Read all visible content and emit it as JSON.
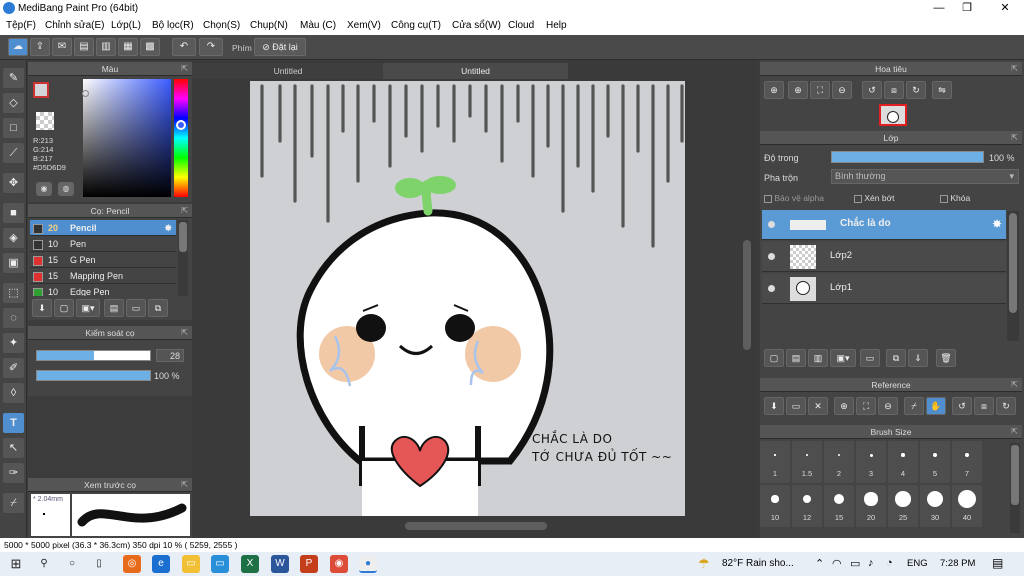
{
  "window": {
    "title": "MediBang Paint Pro (64bit)",
    "minimize": "—",
    "restore": "❐",
    "close": "✕"
  },
  "menu": [
    "Tệp(F)",
    "Chỉnh sửa(E)",
    "Lớp(L)",
    "Bộ lọc(R)",
    "Chọn(S)",
    "Chụp(N)",
    "Màu (C)",
    "Xem(V)",
    "Công cụ(T)",
    "Cửa sổ(W)",
    "Cloud",
    "Help"
  ],
  "toolbar": {
    "shortcut_label": "Phím",
    "reset_label": "Đặt lại"
  },
  "color_panel": {
    "title": "Màu",
    "r": "R:213",
    "g": "G:214",
    "b": "B:217",
    "hex": "#D5D6D9"
  },
  "brush_panel": {
    "title": "Cọ: Pencil",
    "brushes": [
      {
        "size": "20",
        "name": "Pencil",
        "color": "#333333",
        "selected": true
      },
      {
        "size": "10",
        "name": "Pen",
        "color": "#333333",
        "selected": false
      },
      {
        "size": "15",
        "name": "G Pen",
        "color": "#e03030",
        "selected": false
      },
      {
        "size": "15",
        "name": "Mapping Pen",
        "color": "#e03030",
        "selected": false
      },
      {
        "size": "10",
        "name": "Edge Pen",
        "color": "#30a030",
        "selected": false
      }
    ]
  },
  "brush_control": {
    "title": "Kiểm soát cọ",
    "size": "28",
    "opacity": "100 %",
    "size_fill": 0.5,
    "opacity_fill": 1.0
  },
  "preview_panel": {
    "title": "Xem trước cọ",
    "size_label": "* 2.04mm"
  },
  "tabs": [
    "Untitled",
    "Untitled"
  ],
  "artwork": {
    "line1": "CHẮC LÀ DO",
    "line2": "TỚ CHƯA ĐỦ TỐT ~~"
  },
  "navigator": {
    "title": "Hoa tiêu"
  },
  "layer_panel": {
    "title": "Lớp",
    "opacity_label": "Độ trong",
    "opacity_value": "100 %",
    "opacity_fill": 1.0,
    "blend_label": "Pha trộn",
    "blend_value": "Bình thường",
    "protect_alpha": "Bảo vệ alpha",
    "clipping": "Xén bớt",
    "lock": "Khóa",
    "layers": [
      {
        "name": "Chắc là do",
        "selected": true
      },
      {
        "name": "Lớp2",
        "selected": false
      },
      {
        "name": "Lớp1",
        "selected": false
      }
    ]
  },
  "reference_panel": {
    "title": "Reference"
  },
  "brush_size_panel": {
    "title": "Brush Size",
    "row1": [
      "1",
      "1.5",
      "2",
      "3",
      "4",
      "5",
      "7"
    ],
    "row2": [
      "10",
      "12",
      "15",
      "20",
      "25",
      "30",
      "40"
    ]
  },
  "status": {
    "text": "5000 * 5000 pixel  (36.3 * 36.3cm)  350 dpi  10 %  ( 5259, 2555 )"
  },
  "taskbar": {
    "weather": "82°F  Rain sho...",
    "lang": "ENG",
    "time": "7:28 PM"
  }
}
